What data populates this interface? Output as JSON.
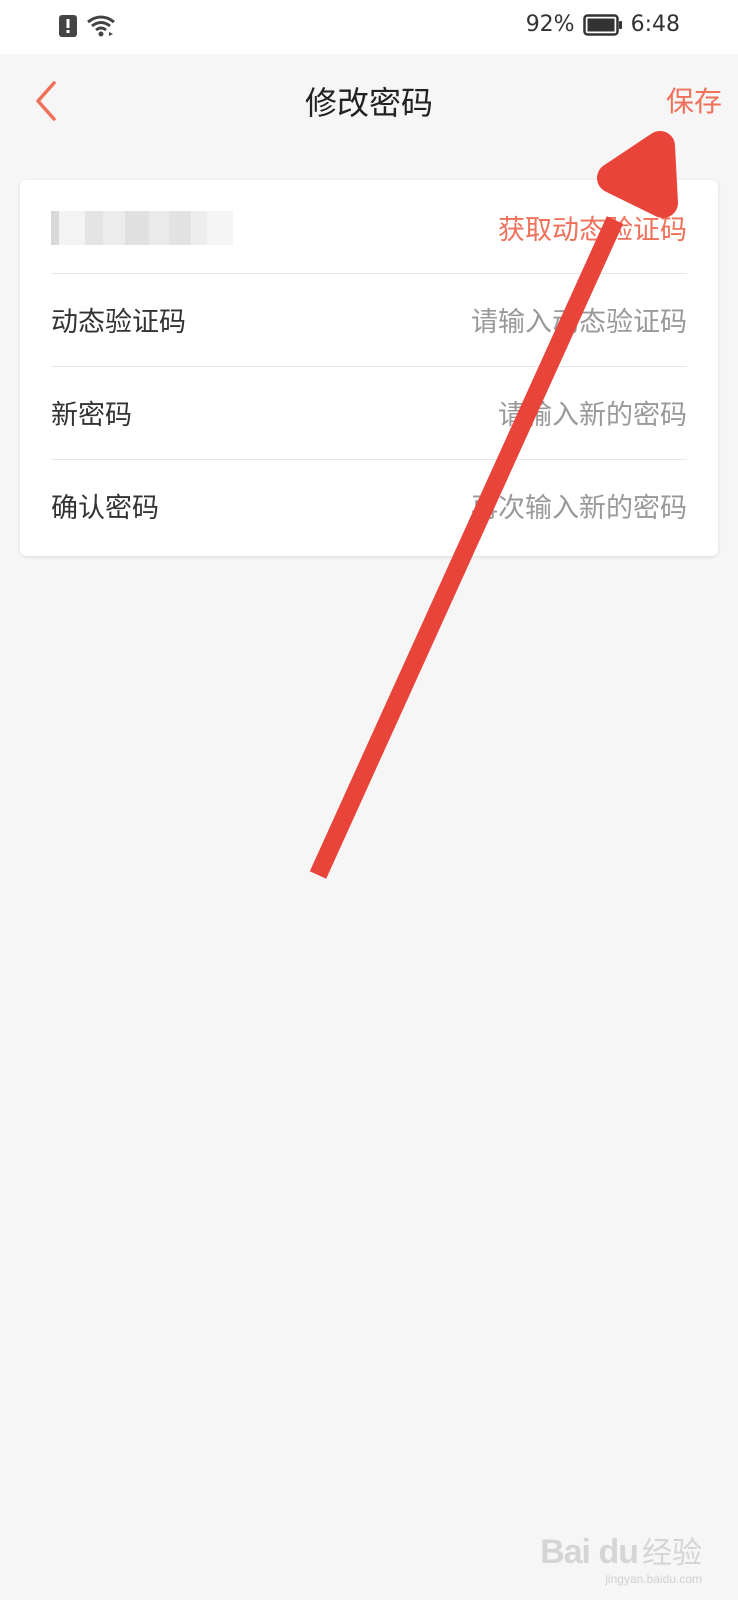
{
  "status_bar": {
    "battery": "92%",
    "time": "6:48"
  },
  "header": {
    "title": "修改密码",
    "save_label": "保存"
  },
  "form": {
    "phone_row": {
      "value_masked": "1",
      "action_label": "获取动态验证码"
    },
    "rows": [
      {
        "label": "动态验证码",
        "placeholder": "请输入动态验证码"
      },
      {
        "label": "新密码",
        "placeholder": "请输入新的密码"
      },
      {
        "label": "确认密码",
        "placeholder": "再次输入新的密码"
      }
    ]
  },
  "watermark": {
    "logo": "Bai du",
    "text": "经验",
    "url": "jingyan.baidu.com"
  },
  "colors": {
    "accent": "#f0705a",
    "annotation_arrow": "#e8443a",
    "background": "#f6f6f6"
  }
}
